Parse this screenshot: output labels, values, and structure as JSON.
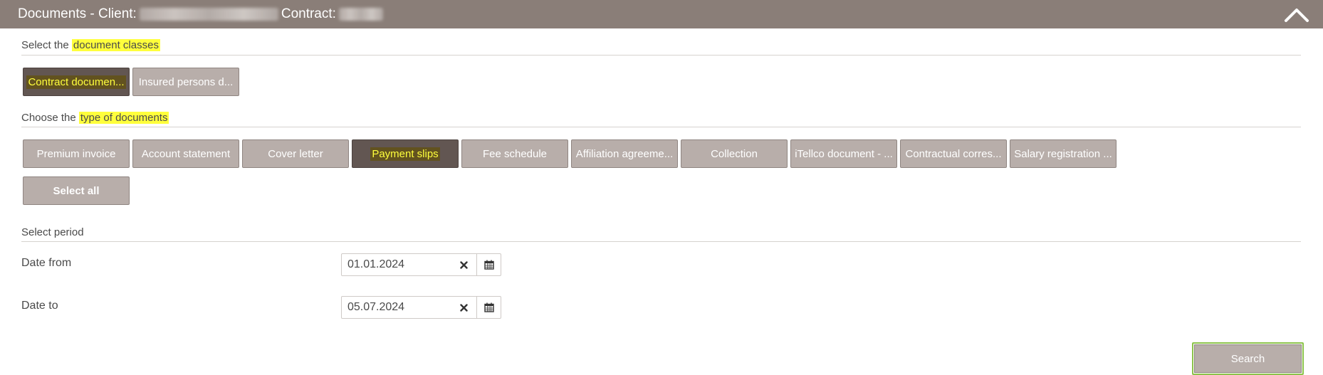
{
  "header": {
    "title_prefix": "Documents - Client:",
    "contract_label": "Contract:"
  },
  "document_classes": {
    "label_plain": "Select the ",
    "label_highlight": "document classes",
    "buttons": [
      "Contract documen...",
      "Insured persons d..."
    ],
    "selected_index": 0
  },
  "document_types": {
    "label_plain": "Choose the ",
    "label_highlight": "type of documents",
    "buttons": [
      "Premium invoice",
      "Account statement",
      "Cover letter",
      "Payment slips",
      "Fee schedule",
      "Affiliation agreeme...",
      "Collection",
      "iTellco document - ...",
      "Contractual corres...",
      "Salary registration ..."
    ],
    "selected_index": 3,
    "select_all": "Select all"
  },
  "period": {
    "label": "Select period",
    "date_from_label": "Date from",
    "date_from_value": "01.01.2024",
    "date_to_label": "Date to",
    "date_to_value": "05.07.2024"
  },
  "search_label": "Search",
  "colors": {
    "header_bg": "#8a7e78",
    "button_bg": "#b8aeaa",
    "button_selected_bg": "#625652",
    "highlight": "#ffff3c",
    "search_focus": "#8bc34a"
  },
  "icons": {
    "collapse": "chevron-up-icon",
    "clear": "close-icon",
    "calendar": "calendar-icon"
  }
}
